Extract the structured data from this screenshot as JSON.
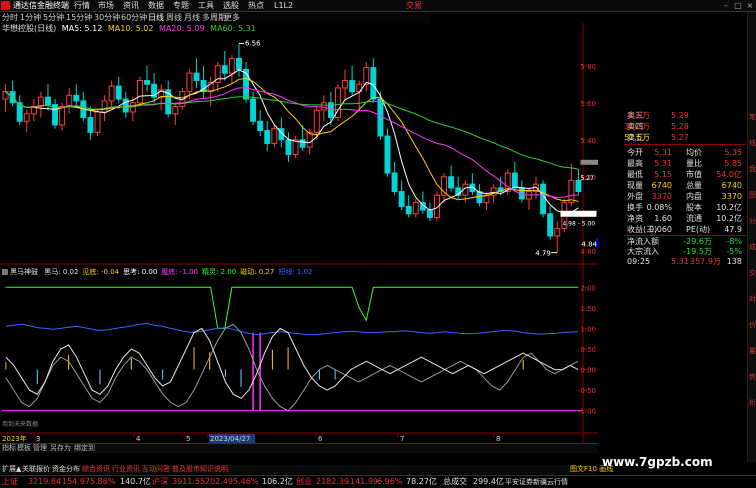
{
  "menu": {
    "app_title": "通达信金融终端",
    "items": [
      "行情",
      "市场",
      "资讯",
      "数据",
      "专题",
      "工具",
      "选股",
      "热点",
      "L1L2"
    ],
    "trade": "交易"
  },
  "periods": {
    "items": [
      "分时",
      "1分钟",
      "5分钟",
      "15分钟",
      "30分钟",
      "60分钟",
      "日线",
      "周线",
      "月线",
      "多周期",
      "更多"
    ],
    "active_index": 6
  },
  "main_legend": {
    "title": "华懋控股(日线)",
    "ma5": "MA5: 5.12",
    "ma10": "MA10: 5.02",
    "ma20": "MA20: 5.09",
    "ma60": "MA60: 5.31"
  },
  "price_axis": {
    "ticks": [
      "5.80",
      "5.60",
      "5.40",
      "5.20",
      "5.00",
      "4.80"
    ],
    "last_price": "4.84"
  },
  "annotations": {
    "high": "6.56",
    "low": "4.79",
    "price_527": "5.27",
    "range_label": "4.98 - 5.00"
  },
  "indicator_legend": {
    "name": "黑马神鼓",
    "items": [
      {
        "text": "黑马: 0.02",
        "color": "#e0e0e0"
      },
      {
        "text": "见底: -0.04",
        "color": "#ffd000"
      },
      {
        "text": "思考: 0.00",
        "color": "#ffffff"
      },
      {
        "text": "魔底: -1.00",
        "color": "#ff33ff"
      },
      {
        "text": "精灵: 2.00",
        "color": "#33ff33"
      },
      {
        "text": "磁动: 0.27",
        "color": "#ffd000"
      },
      {
        "text": "短线: 1.02",
        "color": "#3366ff"
      }
    ]
  },
  "indicator_axis": {
    "ticks": [
      "2.00",
      "1.50",
      "1.00",
      "0.50",
      "0.00",
      "-0.50",
      "-1.00"
    ]
  },
  "quote_panel": {
    "rows": [
      {
        "label": "卖三",
        "price": "5.29",
        "vol": "6.6万",
        "pc": "#e33",
        "vc": "#e33"
      },
      {
        "label": "卖四",
        "price": "5.28",
        "vol": "39.2万",
        "pc": "#e33",
        "vc": "#e33"
      },
      {
        "label": "卖五",
        "price": "5.27",
        "vol": "52.6万",
        "pc": "#e33",
        "vc": "#ffd000"
      },
      {
        "label": "今开",
        "price": "5.31",
        "vol": "",
        "pc": "#e33",
        "vc": "#e33"
      },
      {
        "label": "最高",
        "price": "5.31",
        "vol": "",
        "pc": "#e33",
        "vc": "#e33"
      },
      {
        "label": "最低",
        "price": "5.15",
        "vol": "",
        "pc": "#e33",
        "vc": "#e33"
      },
      {
        "label": "现量",
        "price": "6740",
        "vol": "",
        "pc": "#ffd000",
        "vc": "#e33"
      },
      {
        "label": "外盘",
        "price": "3370",
        "vol": "",
        "pc": "#e33",
        "vc": "#e33"
      },
      {
        "label": "换手",
        "price": "0.08%",
        "vol": "",
        "pc": "#e0e0e0",
        "vc": "#e33"
      },
      {
        "label": "净资",
        "price": "1.60",
        "vol": "",
        "pc": "#e0e0e0",
        "vc": "#e33"
      },
      {
        "label": "收益(三)",
        "price": "0.060",
        "vol": "",
        "pc": "#e0e0e0",
        "vc": "#e33"
      }
    ],
    "right_rows": [
      {
        "label": "均价",
        "value": "5.35"
      },
      {
        "label": "量比",
        "value": "5.85"
      },
      {
        "label": "市值",
        "value": "54.0亿"
      },
      {
        "label": "总量",
        "value": "6740"
      },
      {
        "label": "内盘",
        "value": "3370"
      },
      {
        "label": "股本",
        "value": "10.2亿"
      },
      {
        "label": "流通",
        "value": "10.2亿"
      },
      {
        "label": "PE(动)",
        "value": "47.9"
      }
    ],
    "flows": [
      {
        "label": "净流入额",
        "value": "-29.6万",
        "pct": "-8%"
      },
      {
        "label": "大宗流入",
        "value": "-19.5万",
        "pct": "-5%"
      }
    ],
    "trade_time": "09:25",
    "trade_price": "5.31",
    "trade_amount": "357.9万",
    "trade_vol": "138"
  },
  "right_strip": [
    "笔",
    "线",
    "盘",
    "图",
    "分",
    "成",
    "交",
    "对",
    "价",
    "量",
    "势",
    "析"
  ],
  "bottom_axis": {
    "dates": [
      "2023年",
      "3",
      "4",
      "5",
      "2023/04/27",
      "6",
      "7",
      "8"
    ],
    "footnote": "用到未来数据"
  },
  "tabs": [
    "指标",
    "模板",
    "管理",
    "另存为",
    "绑定到"
  ],
  "subtabs": [
    "扩展▲",
    "关联报价",
    "资金分布",
    "综合资讯",
    "行业资讯",
    "互动问答",
    "普及股市知识说明"
  ],
  "status": {
    "sh_label": "上证",
    "sh_val": "3219.84",
    "sh_chg": "154.97",
    "sh_pct": "5.86%",
    "sh_amt": "140.7亿",
    "sz_label": "沪深",
    "sz_val": "3911.55",
    "sz_chg": "202.49",
    "sz_pct": "5.46%",
    "sz_amt": "106.2亿",
    "cy_label": "创业",
    "cy_val": "2182.39",
    "cy_chg": "141.99",
    "cy_pct": "6.96%",
    "cy_amt": "78.27亿",
    "total_label": "总成交",
    "total_val": "299.4亿",
    "broker": "平安证券新疆云行情",
    "f10": "图文F10 画线"
  },
  "watermark": "www.7gpzb.com",
  "chart_data": {
    "type": "candlestick",
    "ma_colors": {
      "ma5": "#ffffff",
      "ma10": "#ffd000",
      "ma20": "#ff33ff",
      "ma60": "#33cc33"
    },
    "ylim": [
      4.75,
      5.95
    ],
    "candles": [
      [
        5.62,
        5.7,
        5.55,
        5.66
      ],
      [
        5.66,
        5.72,
        5.58,
        5.6
      ],
      [
        5.6,
        5.64,
        5.48,
        5.5
      ],
      [
        5.5,
        5.56,
        5.44,
        5.54
      ],
      [
        5.54,
        5.62,
        5.5,
        5.58
      ],
      [
        5.58,
        5.66,
        5.52,
        5.63
      ],
      [
        5.63,
        5.7,
        5.56,
        5.59
      ],
      [
        5.59,
        5.62,
        5.46,
        5.48
      ],
      [
        5.48,
        5.6,
        5.45,
        5.58
      ],
      [
        5.58,
        5.68,
        5.54,
        5.64
      ],
      [
        5.64,
        5.7,
        5.58,
        5.61
      ],
      [
        5.61,
        5.66,
        5.5,
        5.52
      ],
      [
        5.52,
        5.58,
        5.4,
        5.44
      ],
      [
        5.44,
        5.56,
        5.42,
        5.55
      ],
      [
        5.55,
        5.64,
        5.5,
        5.61
      ],
      [
        5.61,
        5.72,
        5.58,
        5.69
      ],
      [
        5.69,
        5.74,
        5.6,
        5.62
      ],
      [
        5.62,
        5.66,
        5.52,
        5.55
      ],
      [
        5.55,
        5.63,
        5.5,
        5.6
      ],
      [
        5.6,
        5.74,
        5.58,
        5.72
      ],
      [
        5.72,
        5.8,
        5.66,
        5.7
      ],
      [
        5.7,
        5.76,
        5.6,
        5.63
      ],
      [
        5.63,
        5.7,
        5.56,
        5.67
      ],
      [
        5.67,
        5.72,
        5.52,
        5.54
      ],
      [
        5.54,
        5.6,
        5.48,
        5.58
      ],
      [
        5.58,
        5.68,
        5.56,
        5.66
      ],
      [
        5.66,
        5.78,
        5.62,
        5.76
      ],
      [
        5.76,
        5.84,
        5.68,
        5.72
      ],
      [
        5.72,
        5.8,
        5.62,
        5.66
      ],
      [
        5.66,
        5.74,
        5.58,
        5.71
      ],
      [
        5.71,
        5.82,
        5.66,
        5.8
      ],
      [
        5.8,
        5.88,
        5.72,
        5.76
      ],
      [
        5.76,
        5.86,
        5.7,
        5.84
      ],
      [
        5.84,
        5.92,
        5.74,
        5.78
      ],
      [
        5.78,
        5.82,
        5.6,
        5.62
      ],
      [
        5.62,
        5.66,
        5.48,
        5.5
      ],
      [
        5.5,
        5.56,
        5.42,
        5.45
      ],
      [
        5.45,
        5.5,
        5.34,
        5.38
      ],
      [
        5.38,
        5.48,
        5.36,
        5.46
      ],
      [
        5.46,
        5.52,
        5.36,
        5.4
      ],
      [
        5.4,
        5.44,
        5.28,
        5.32
      ],
      [
        5.32,
        5.42,
        5.3,
        5.4
      ],
      [
        5.4,
        5.48,
        5.34,
        5.36
      ],
      [
        5.36,
        5.46,
        5.32,
        5.44
      ],
      [
        5.44,
        5.58,
        5.4,
        5.56
      ],
      [
        5.56,
        5.64,
        5.5,
        5.6
      ],
      [
        5.6,
        5.66,
        5.48,
        5.52
      ],
      [
        5.52,
        5.7,
        5.5,
        5.68
      ],
      [
        5.68,
        5.78,
        5.62,
        5.72
      ],
      [
        5.72,
        5.8,
        5.64,
        5.66
      ],
      [
        5.66,
        5.72,
        5.56,
        5.7
      ],
      [
        5.7,
        5.82,
        5.66,
        5.79
      ],
      [
        5.79,
        5.84,
        5.6,
        5.62
      ],
      [
        5.62,
        5.66,
        5.4,
        5.42
      ],
      [
        5.42,
        5.46,
        5.2,
        5.22
      ],
      [
        5.22,
        5.28,
        5.1,
        5.12
      ],
      [
        5.12,
        5.18,
        5.02,
        5.04
      ],
      [
        5.04,
        5.1,
        4.98,
        5.0
      ],
      [
        5.0,
        5.08,
        4.98,
        5.06
      ],
      [
        5.06,
        5.12,
        5.0,
        5.02
      ],
      [
        5.02,
        5.06,
        4.96,
        4.98
      ],
      [
        4.98,
        5.12,
        4.96,
        5.1
      ],
      [
        5.1,
        5.22,
        5.06,
        5.2
      ],
      [
        5.2,
        5.26,
        5.12,
        5.14
      ],
      [
        5.14,
        5.2,
        5.08,
        5.1
      ],
      [
        5.1,
        5.18,
        5.06,
        5.16
      ],
      [
        5.16,
        5.22,
        5.1,
        5.12
      ],
      [
        5.12,
        5.16,
        5.04,
        5.06
      ],
      [
        5.06,
        5.12,
        5.02,
        5.1
      ],
      [
        5.1,
        5.16,
        5.06,
        5.14
      ],
      [
        5.14,
        5.2,
        5.1,
        5.12
      ],
      [
        5.12,
        5.24,
        5.1,
        5.22
      ],
      [
        5.22,
        5.28,
        5.12,
        5.14
      ],
      [
        5.14,
        5.18,
        5.06,
        5.08
      ],
      [
        5.08,
        5.14,
        5.02,
        5.12
      ],
      [
        5.12,
        5.2,
        5.08,
        5.16
      ],
      [
        5.16,
        5.18,
        4.98,
        5.0
      ],
      [
        5.0,
        5.04,
        4.86,
        4.88
      ],
      [
        4.88,
        4.96,
        4.79,
        4.92
      ],
      [
        4.92,
        5.08,
        4.9,
        5.06
      ],
      [
        5.06,
        5.27,
        5.04,
        5.18
      ],
      [
        5.18,
        5.24,
        5.1,
        5.12
      ]
    ],
    "indicator": {
      "ylim": [
        -1.3,
        2.3
      ],
      "white": [
        0.3,
        0.1,
        -0.2,
        -0.5,
        -0.6,
        -0.3,
        0.2,
        0.5,
        0.6,
        0.3,
        -0.1,
        -0.5,
        -0.6,
        -0.4,
        0.0,
        0.3,
        0.5,
        0.4,
        0.1,
        -0.2,
        -0.4,
        -0.3,
        0.1,
        0.5,
        0.9,
        1.0,
        0.7,
        0.2,
        -0.3,
        -0.6,
        -0.7,
        -0.5,
        -0.1,
        0.4,
        0.8,
        1.0,
        0.9,
        0.5,
        0.1,
        -0.2,
        -0.4,
        -0.5,
        -0.4,
        -0.2,
        0.0,
        0.1,
        0.2,
        0.1,
        0.0,
        -0.1,
        0.0,
        0.1,
        0.2,
        0.3,
        0.2,
        0.1,
        0.0,
        -0.1,
        0.0,
        0.1,
        0.0,
        -0.1,
        0.0,
        0.1,
        0.2,
        0.3,
        0.4,
        0.3,
        0.2,
        0.1,
        0.0,
        0.0,
        0.1,
        0.0
      ],
      "gray": [
        -0.2,
        -0.5,
        -0.8,
        -0.9,
        -0.7,
        -0.3,
        0.1,
        0.3,
        0.2,
        -0.1,
        -0.4,
        -0.7,
        -0.8,
        -0.6,
        -0.2,
        0.1,
        0.3,
        0.2,
        0.0,
        -0.3,
        -0.6,
        -0.8,
        -0.9,
        -0.8,
        -0.5,
        -0.1,
        0.3,
        0.7,
        1.0,
        1.1,
        0.9,
        0.5,
        0.0,
        -0.4,
        -0.7,
        -0.9,
        -1.0,
        -0.8,
        -0.5,
        -0.2,
        0.0,
        0.1,
        0.0,
        -0.1,
        -0.2,
        -0.3,
        -0.2,
        -0.1,
        0.0,
        0.1,
        0.0,
        -0.1,
        -0.2,
        -0.3,
        -0.2,
        -0.1,
        0.0,
        0.1,
        0.2,
        0.1,
        0.0,
        -0.2,
        -0.4,
        -0.5,
        -0.3,
        0.0,
        0.3,
        0.4,
        0.2,
        0.0,
        -0.1,
        0.0,
        0.1,
        0.2
      ],
      "blue": [
        1.05,
        1.08,
        1.1,
        1.07,
        1.02,
        1.0,
        0.98,
        1.0,
        1.03,
        1.05,
        1.02,
        0.98,
        0.95,
        0.97,
        1.0,
        1.03,
        1.06,
        1.1,
        1.12,
        1.08,
        1.05,
        1.0,
        0.96,
        0.92,
        0.9,
        0.93,
        0.97,
        1.0,
        1.02,
        0.98,
        0.92,
        0.88,
        0.85,
        0.87,
        0.9,
        0.92,
        0.9,
        0.88,
        0.86,
        0.85,
        0.86,
        0.88,
        0.9,
        0.92,
        0.93,
        0.92,
        0.9,
        0.9,
        0.91,
        0.92,
        0.93,
        0.94,
        0.92,
        0.9,
        0.88,
        0.9,
        0.92,
        0.9,
        0.88,
        0.87,
        0.88,
        0.9,
        0.92,
        0.94,
        0.95,
        0.93,
        0.9,
        0.88,
        0.86,
        0.87,
        0.88,
        0.9,
        0.91,
        0.92
      ]
    }
  }
}
